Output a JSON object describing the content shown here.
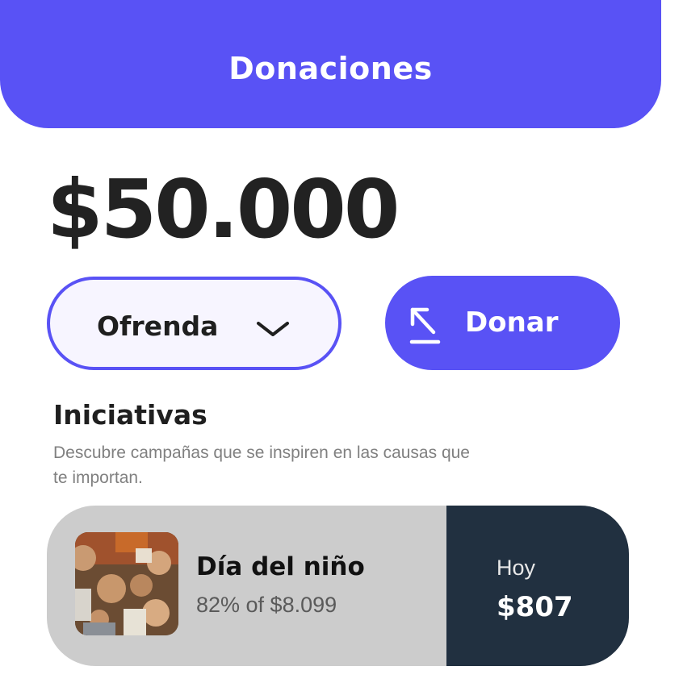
{
  "header": {
    "title": "Donaciones"
  },
  "amount": "$50.000",
  "donation_type": {
    "selected": "Ofrenda"
  },
  "donate_button": {
    "label": "Donar"
  },
  "initiatives": {
    "title": "Iniciativas",
    "description": "Descubre campañas que se inspiren en las causas que te importan.",
    "cards": [
      {
        "title": "Día del niño",
        "progress_text": "82% of $8.099",
        "progress_fraction": 0.82,
        "today_label": "Hoy",
        "today_amount": "$807"
      }
    ]
  },
  "colors": {
    "accent": "#5952F5",
    "select_background": "#F7F5FF",
    "card_background": "#CCCCCC",
    "card_dark": "#213040",
    "text_dark": "#222222",
    "text_muted": "#808080"
  },
  "icons": {
    "dropdown": "chevron-down-icon",
    "donate": "arrow-up-left-icon",
    "card_image": "children-photo"
  }
}
